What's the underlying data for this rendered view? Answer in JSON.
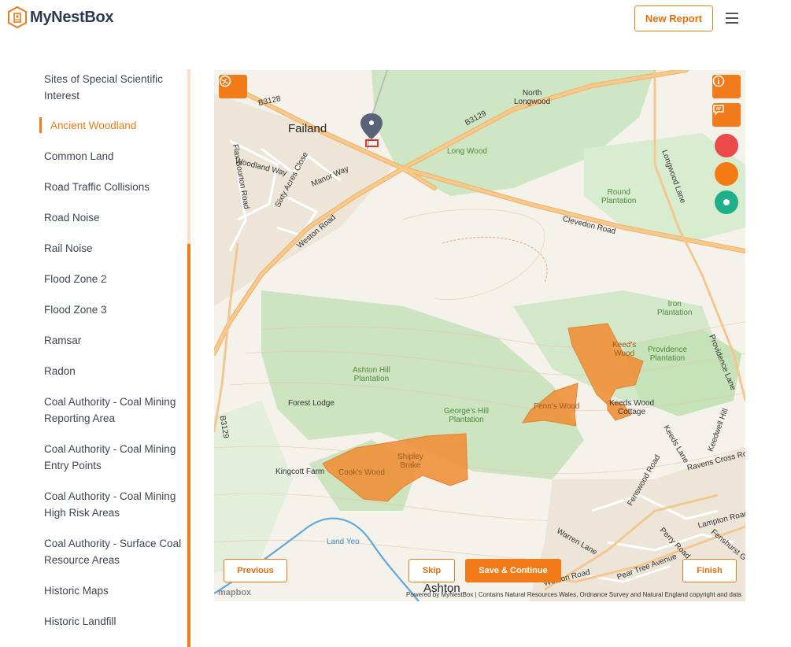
{
  "header": {
    "brand": "MyNestBox",
    "new_report_label": "New Report"
  },
  "sidebar": {
    "items": [
      {
        "label": "Sites of Special Scientific Interest",
        "active": false
      },
      {
        "label": "Ancient Woodland",
        "active": true
      },
      {
        "label": "Common Land",
        "active": false
      },
      {
        "label": "Road Traffic Collisions",
        "active": false
      },
      {
        "label": "Road Noise",
        "active": false
      },
      {
        "label": "Rail Noise",
        "active": false
      },
      {
        "label": "Flood Zone 2",
        "active": false
      },
      {
        "label": "Flood Zone 3",
        "active": false
      },
      {
        "label": "Ramsar",
        "active": false
      },
      {
        "label": "Radon",
        "active": false
      },
      {
        "label": "Coal Authority - Coal Mining Reporting Area",
        "active": false
      },
      {
        "label": "Coal Authority - Coal Mining Entry Points",
        "active": false
      },
      {
        "label": "Coal Authority - Coal Mining High Risk Areas",
        "active": false
      },
      {
        "label": "Coal Authority - Surface Coal Resource Areas",
        "active": false
      },
      {
        "label": "Historic Maps",
        "active": false
      },
      {
        "label": "Historic Landfill",
        "active": false
      }
    ]
  },
  "map": {
    "labels": {
      "failand": "Failand",
      "north_longwood": "North\nLongwood",
      "long_wood": "Long Wood",
      "round_plantation": "Round\nPlantation",
      "clevedon_road": "Clevedon Road",
      "longwood_lane": "Longwood Lane",
      "b3129": "B3129",
      "b3128": "B3128",
      "woodland_way": "Woodland Way",
      "sixty_acres_close": "Sixty Acres Close",
      "manor_way": "Manor Way",
      "flax_bourton_road": "Flax Bourton Road",
      "weston_road": "Weston Road",
      "iron_plantation": "Iron\nPlantation",
      "providence_plantation": "Providence\nPlantation",
      "providence_lane": "Providence Lane",
      "keeds_wood": "Keed's\nWood",
      "keeds_wood_cottage": "Keeds Wood\nCottage",
      "fenns_wood": "Fenn's Wood",
      "ashton_hill_plantation": "Ashton Hill\nPlantation",
      "forest_lodge": "Forest Lodge",
      "georges_hill_plantation": "George's Hill\nPlantation",
      "kingcott_farm": "Kingcott Farm",
      "cooks_wood": "Cook's Wood",
      "shipley_brake": "Shipley\nBrake",
      "land_yeo": "Land Yeo",
      "keeds_lane": "Keeds Lane",
      "keedwell_hill": "Keedwell Hill",
      "ravens_cross_road": "Ravens Cross Road",
      "lampton_road": "Lampton Road",
      "fenshurst": "Fenshurst G",
      "perry_road": "Perry Road",
      "warren_lane": "Warren Lane",
      "pear_tree_avenue": "Pear Tree Avenue",
      "weston_road_2": "Weston Road",
      "ashton": "Ashton",
      "b3129_west": "B3129",
      "fenswood_road": "Fenswood Road"
    },
    "attribution": "Powered by MyNestBox | Contains Natural Resources Wales, Ordnance Survey and Natural England copyright and data",
    "mapbox_label": "mapbox",
    "status_dots": {
      "red": "#ec4a4a",
      "orange": "#f57a14",
      "green": "#1fb08a"
    },
    "icons": [
      "layers-icon",
      "info-icon",
      "comment-icon"
    ]
  },
  "nav": {
    "previous": "Previous",
    "skip": "Skip",
    "save_continue": "Save & Continue",
    "finish": "Finish"
  },
  "colors": {
    "accent": "#f27b1a",
    "woodland_polygon": "#f0913a"
  }
}
